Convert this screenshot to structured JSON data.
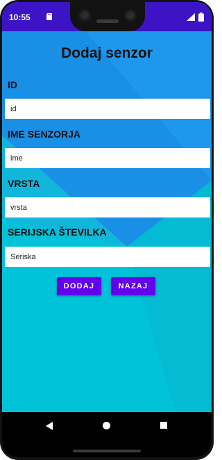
{
  "status_bar": {
    "time": "10:55",
    "icons": [
      "sd-card-icon",
      "signal-icon",
      "battery-icon"
    ]
  },
  "form": {
    "title": "Dodaj senzor",
    "fields": [
      {
        "label": "ID",
        "placeholder": "id"
      },
      {
        "label": "IME SENZORJA",
        "placeholder": "ime"
      },
      {
        "label": "VRSTA",
        "placeholder": "vrsta"
      },
      {
        "label": "SERIJSKA ŠTEVILKA",
        "placeholder": "Seriska"
      }
    ],
    "buttons": {
      "add": "DODAJ",
      "back": "NAZAJ"
    }
  },
  "nav_bar": {
    "icons": [
      "back-icon",
      "home-icon",
      "recents-icon"
    ]
  },
  "colors": {
    "status_bar": "#3c14c6",
    "accent_button": "#6200ee",
    "background_light": "#00c2d8",
    "background_blue": "#1a8fe6"
  }
}
